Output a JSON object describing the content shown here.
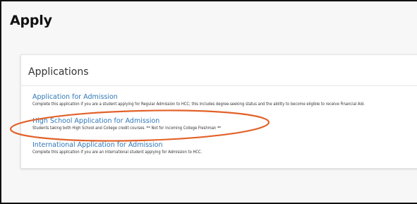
{
  "page": {
    "title": "Apply"
  },
  "applications_panel": {
    "title": "Applications",
    "items": [
      {
        "link_label": "Application for Admission",
        "description": "Complete this application if you are a student applying for Regular Admission to HCC; this includes degree-seeking status and the ability to become eligible to receive Financial Aid."
      },
      {
        "link_label": "High School Application for Admission",
        "description": "Students taking both High School and College credit courses. ** Not for incoming College Freshman **"
      },
      {
        "link_label": "International Application for Admission",
        "description": "Complete this application if you are an International student applying for Admission to HCC."
      }
    ]
  },
  "annotation": {
    "shape": "ellipse",
    "color": "#e2622a",
    "highlights": "High School Application for Admission"
  },
  "colors": {
    "link": "#2e77b8",
    "page_background": "#f7f7f7",
    "panel_background": "#ffffff",
    "annotation": "#e2622a"
  }
}
